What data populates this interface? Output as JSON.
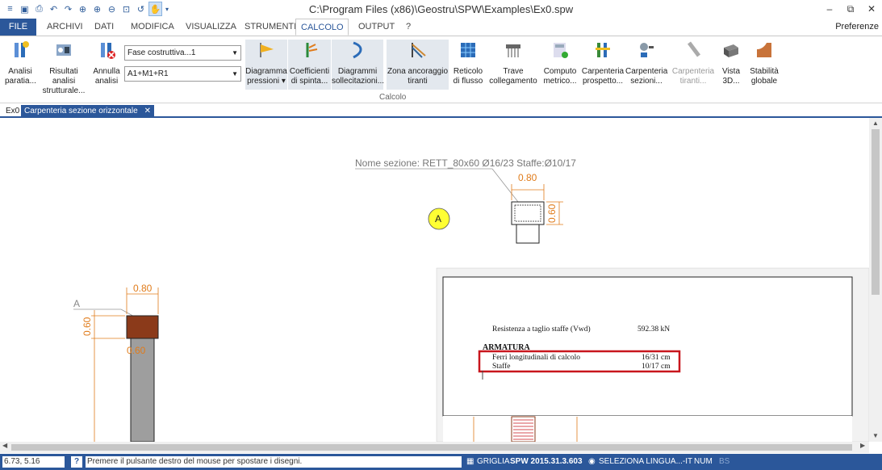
{
  "titlebar": {
    "title": "C:\\Program Files (x86)\\Geostru\\SPW\\Examples\\Ex0.spw",
    "qat": [
      "save-icon",
      "print-preview-icon",
      "undo-icon",
      "redo-icon",
      "zoom-all-icon",
      "zoom-in-icon",
      "zoom-out-icon",
      "zoom-window-icon",
      "zoom-previous-icon",
      "pan-icon"
    ],
    "window_controls": {
      "minimize": "–",
      "restore": "⧉",
      "close": "✕"
    }
  },
  "tabs": [
    "FILE",
    "ARCHIVI",
    "DATI",
    "MODIFICA",
    "VISUALIZZA",
    "STRUMENTI",
    "CALCOLO",
    "OUTPUT",
    "?"
  ],
  "active_tab": "CALCOLO",
  "preferences": "Preferenze",
  "ribbon": {
    "buttons": {
      "analisi": [
        "Analisi",
        "paratia..."
      ],
      "risultati": [
        "Risultati analisi",
        "strutturale..."
      ],
      "annulla": [
        "Annulla",
        "analisi"
      ],
      "diagramma": [
        "Diagramma",
        "pressioni ▾"
      ],
      "coefficienti": [
        "Coefficienti",
        "di spinta..."
      ],
      "sollecitazioni": [
        "Diagrammi",
        "sollecitazioni..."
      ],
      "zona": [
        "Zona ancoraggio",
        "tiranti"
      ],
      "reticolo": [
        "Reticolo",
        "di flusso"
      ],
      "trave": [
        "Trave",
        "collegamento"
      ],
      "computo": [
        "Computo",
        "metrico..."
      ],
      "carp_prospetto": [
        "Carpenteria",
        "prospetto..."
      ],
      "carp_sezioni": [
        "Carpenteria",
        "sezioni..."
      ],
      "carp_tiranti": [
        "Carpenteria",
        "tiranti..."
      ],
      "vista3d": [
        "Vista",
        "3D..."
      ],
      "stabilita": [
        "Stabilità",
        "globale"
      ]
    },
    "combo_fase": "Fase costruttiva...1",
    "combo_combinazione": "A1+M1+R1",
    "group_label": "Calcolo"
  },
  "doc_tabs": {
    "ex0": "Ex0",
    "active": "Carpenteria sezione orizzontale",
    "close": "✕"
  },
  "drawing": {
    "section_name": "Nome sezione: RETT_80x60  Ø16/23 Staffe:Ø10/17",
    "dim_080": "0.80",
    "dim_060": "0.60",
    "marker_a": "A",
    "label_a": "A",
    "dim_060_lower": "0.60"
  },
  "report": {
    "row1_label": "Resistenza a taglio staffe (Vwd)",
    "row1_value": "592.38  kN",
    "heading": "ARMATURA",
    "row2_label": "Ferri longitudinali di calcolo",
    "row2_value": "16/31  cm",
    "row3_label": "Staffe",
    "row3_value": "10/17  cm"
  },
  "colors": {
    "accent": "#2b579a",
    "dim": "#e07b1a",
    "highlight": "#c8161d",
    "marker": "#ffff33"
  },
  "status": {
    "coords": "6.73, 5.16",
    "help": "?",
    "message": "Premere il pulsante destro del mouse per spostare i disegni.",
    "griglia": "GRIGLIA",
    "version": "SPW 2015.31.3.603",
    "lingua": "SELEZIONA LINGUA...-IT",
    "num": "NUM",
    "bs": "BS"
  }
}
